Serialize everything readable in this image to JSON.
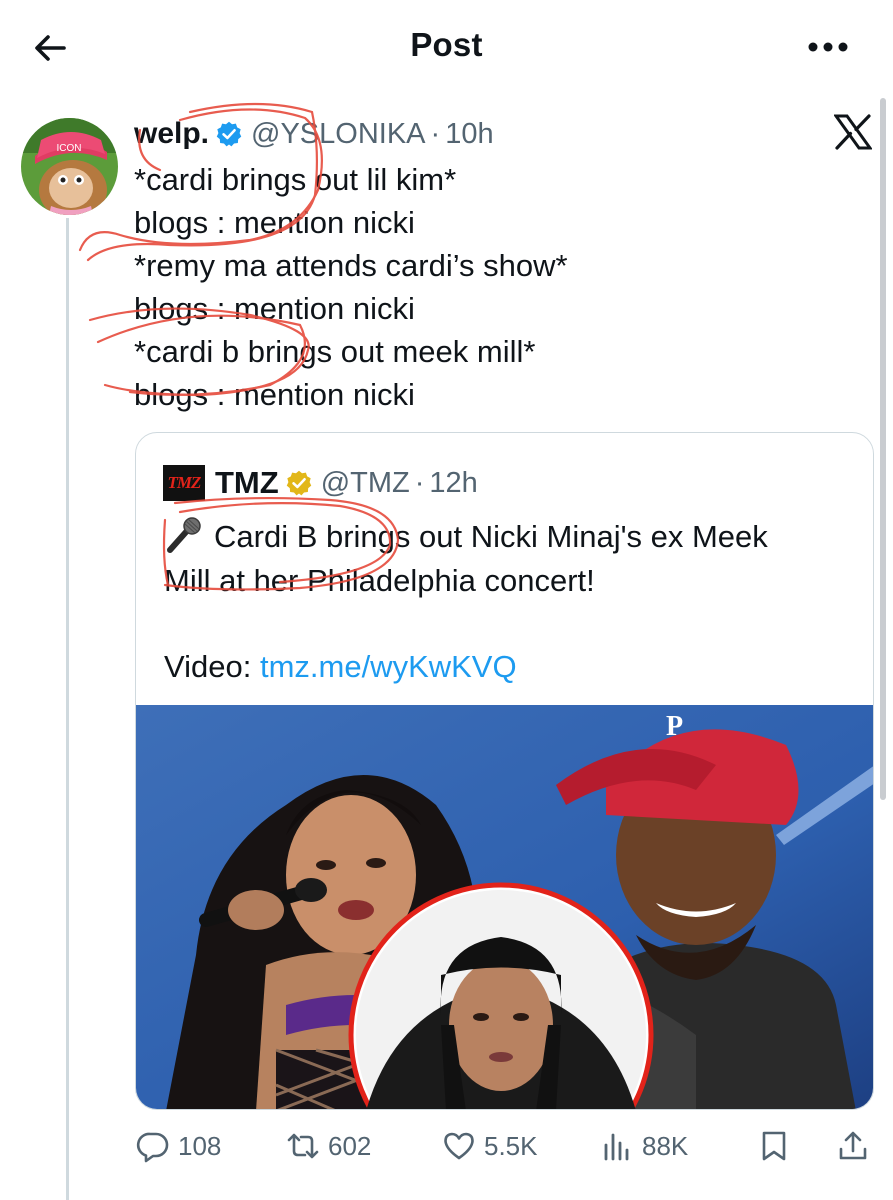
{
  "header": {
    "title": "Post",
    "back_icon": "arrow-left-icon",
    "more_icon": "more-horizontal-icon"
  },
  "post": {
    "display_name": "welp.",
    "handle": "@YSLONIKA",
    "separator": "·",
    "time": "10h",
    "avatar_badge": "ICON",
    "lines": [
      "*cardi brings out lil kim*",
      "blogs : mention nicki",
      "*remy ma attends cardi’s show*",
      "blogs : mention nicki",
      "*cardi b brings out meek mill*",
      "blogs : mention nicki"
    ]
  },
  "quote": {
    "logo_text": "TMZ",
    "display_name": "TMZ",
    "handle": "@TMZ",
    "separator": "·",
    "time": "12h",
    "text_line1": "Cardi B brings out Nicki Minaj's ex Meek",
    "text_line2": "Mill at her Philadelphia concert!",
    "video_label": "Video: ",
    "video_link": "tmz.me/wyKwKVQ",
    "media_icon": "concert-photo"
  },
  "actions": {
    "replies": "108",
    "reposts": "602",
    "likes": "5.5K",
    "views": "88K"
  },
  "colors": {
    "text": "#0f1419",
    "secondary": "#536471",
    "link": "#1d9bf0",
    "verified_blue": "#1d9bf0",
    "verified_gold": "#e2b719",
    "annotation_red": "#e64b3c"
  }
}
